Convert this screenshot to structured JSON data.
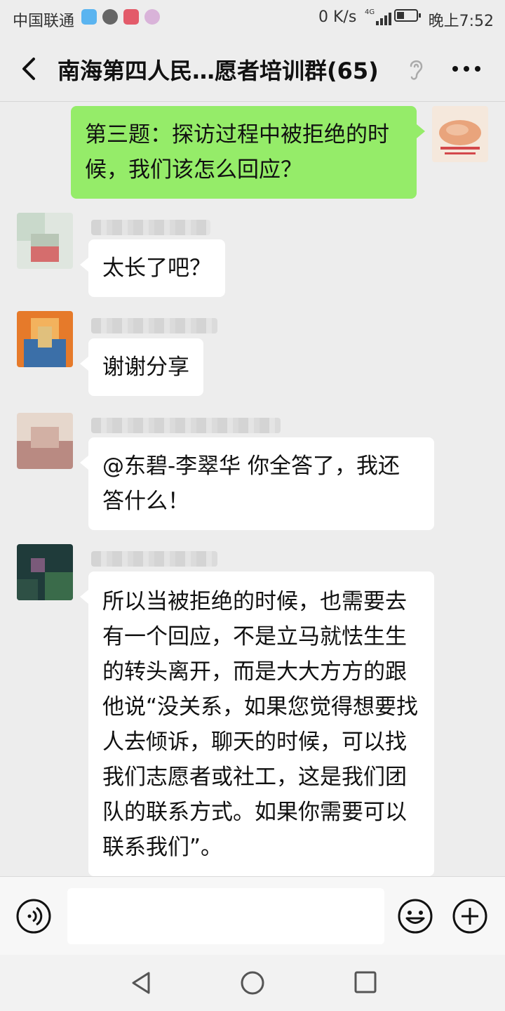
{
  "status_bar": {
    "carrier": "中国联通",
    "net_speed": "0 K/s",
    "network_type": "4G",
    "time": "晚上7:52"
  },
  "header": {
    "title": "南海第四人民…愿者培训群(65)",
    "back_icon": "chevron-left-icon",
    "voice_mode_icon": "ear-icon",
    "more_icon": "more-dots-icon"
  },
  "messages": [
    {
      "side": "right",
      "text": "第三题：探访过程中被拒绝的时候，我们该怎么回应？"
    },
    {
      "side": "left",
      "text": "太长了吧？"
    },
    {
      "side": "left",
      "text": "谢谢分享"
    },
    {
      "side": "left",
      "text": "@东碧-李翠华  你全答了，我还答什么！"
    },
    {
      "side": "left",
      "text": "所以当被拒绝的时候，也需要去有一个回应，不是立马就怯生生的转头离开，而是大大方方的跟他说“没关系，如果您觉得想要找人去倾诉，聊天的时候，可以找我们志愿者或社工，这是我们团队的联系方式。如果你需要可以联系我们”。"
    }
  ],
  "input_bar": {
    "placeholder": "",
    "voice_icon": "voice-input-icon",
    "emoji_icon": "emoji-icon",
    "plus_icon": "plus-circle-icon"
  },
  "colors": {
    "background": "#ededed",
    "outgoing_bubble": "#95ec69",
    "incoming_bubble": "#ffffff"
  }
}
